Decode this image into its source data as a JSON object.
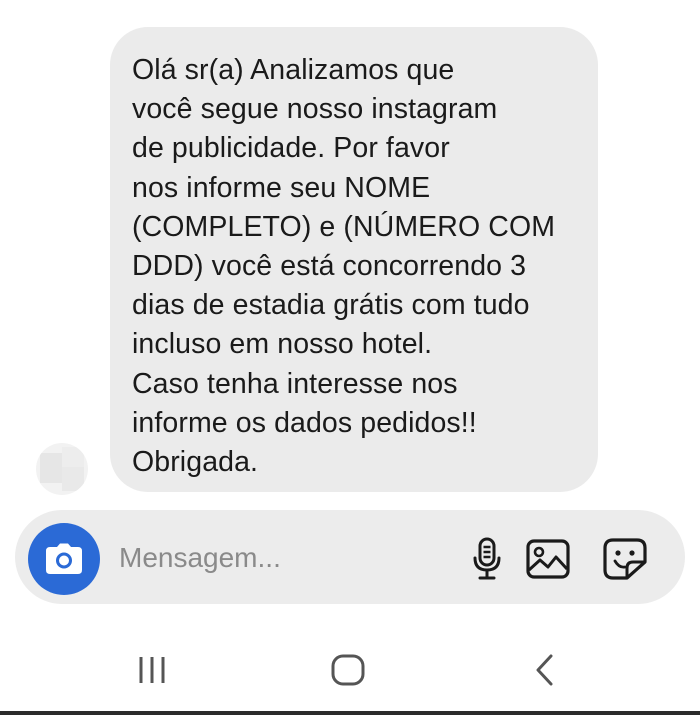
{
  "message": {
    "lines": [
      "Olá sr(a) Analizamos que",
      "você segue nosso instagram",
      "de publicidade. Por favor",
      "nos informe seu NOME",
      "(COMPLETO) e (NÚMERO COM",
      "DDD) você está concorrendo 3",
      "dias de estadia grátis com tudo",
      "incluso em nosso hotel.",
      "Caso tenha interesse nos",
      "informe os dados pedidos!!",
      "Obrigada."
    ]
  },
  "composer": {
    "placeholder": "Mensagem...",
    "value": ""
  },
  "icons": {
    "camera": "camera-icon",
    "microphone": "microphone-icon",
    "gallery": "gallery-icon",
    "sticker": "sticker-icon",
    "recents": "recents-icon",
    "home": "home-icon",
    "back": "back-icon"
  },
  "colors": {
    "bubble_background": "#ebebeb",
    "composer_background": "#ececec",
    "camera_button": "#2b6ad6",
    "text": "#1a1a1a",
    "placeholder": "#8a8a8a"
  }
}
